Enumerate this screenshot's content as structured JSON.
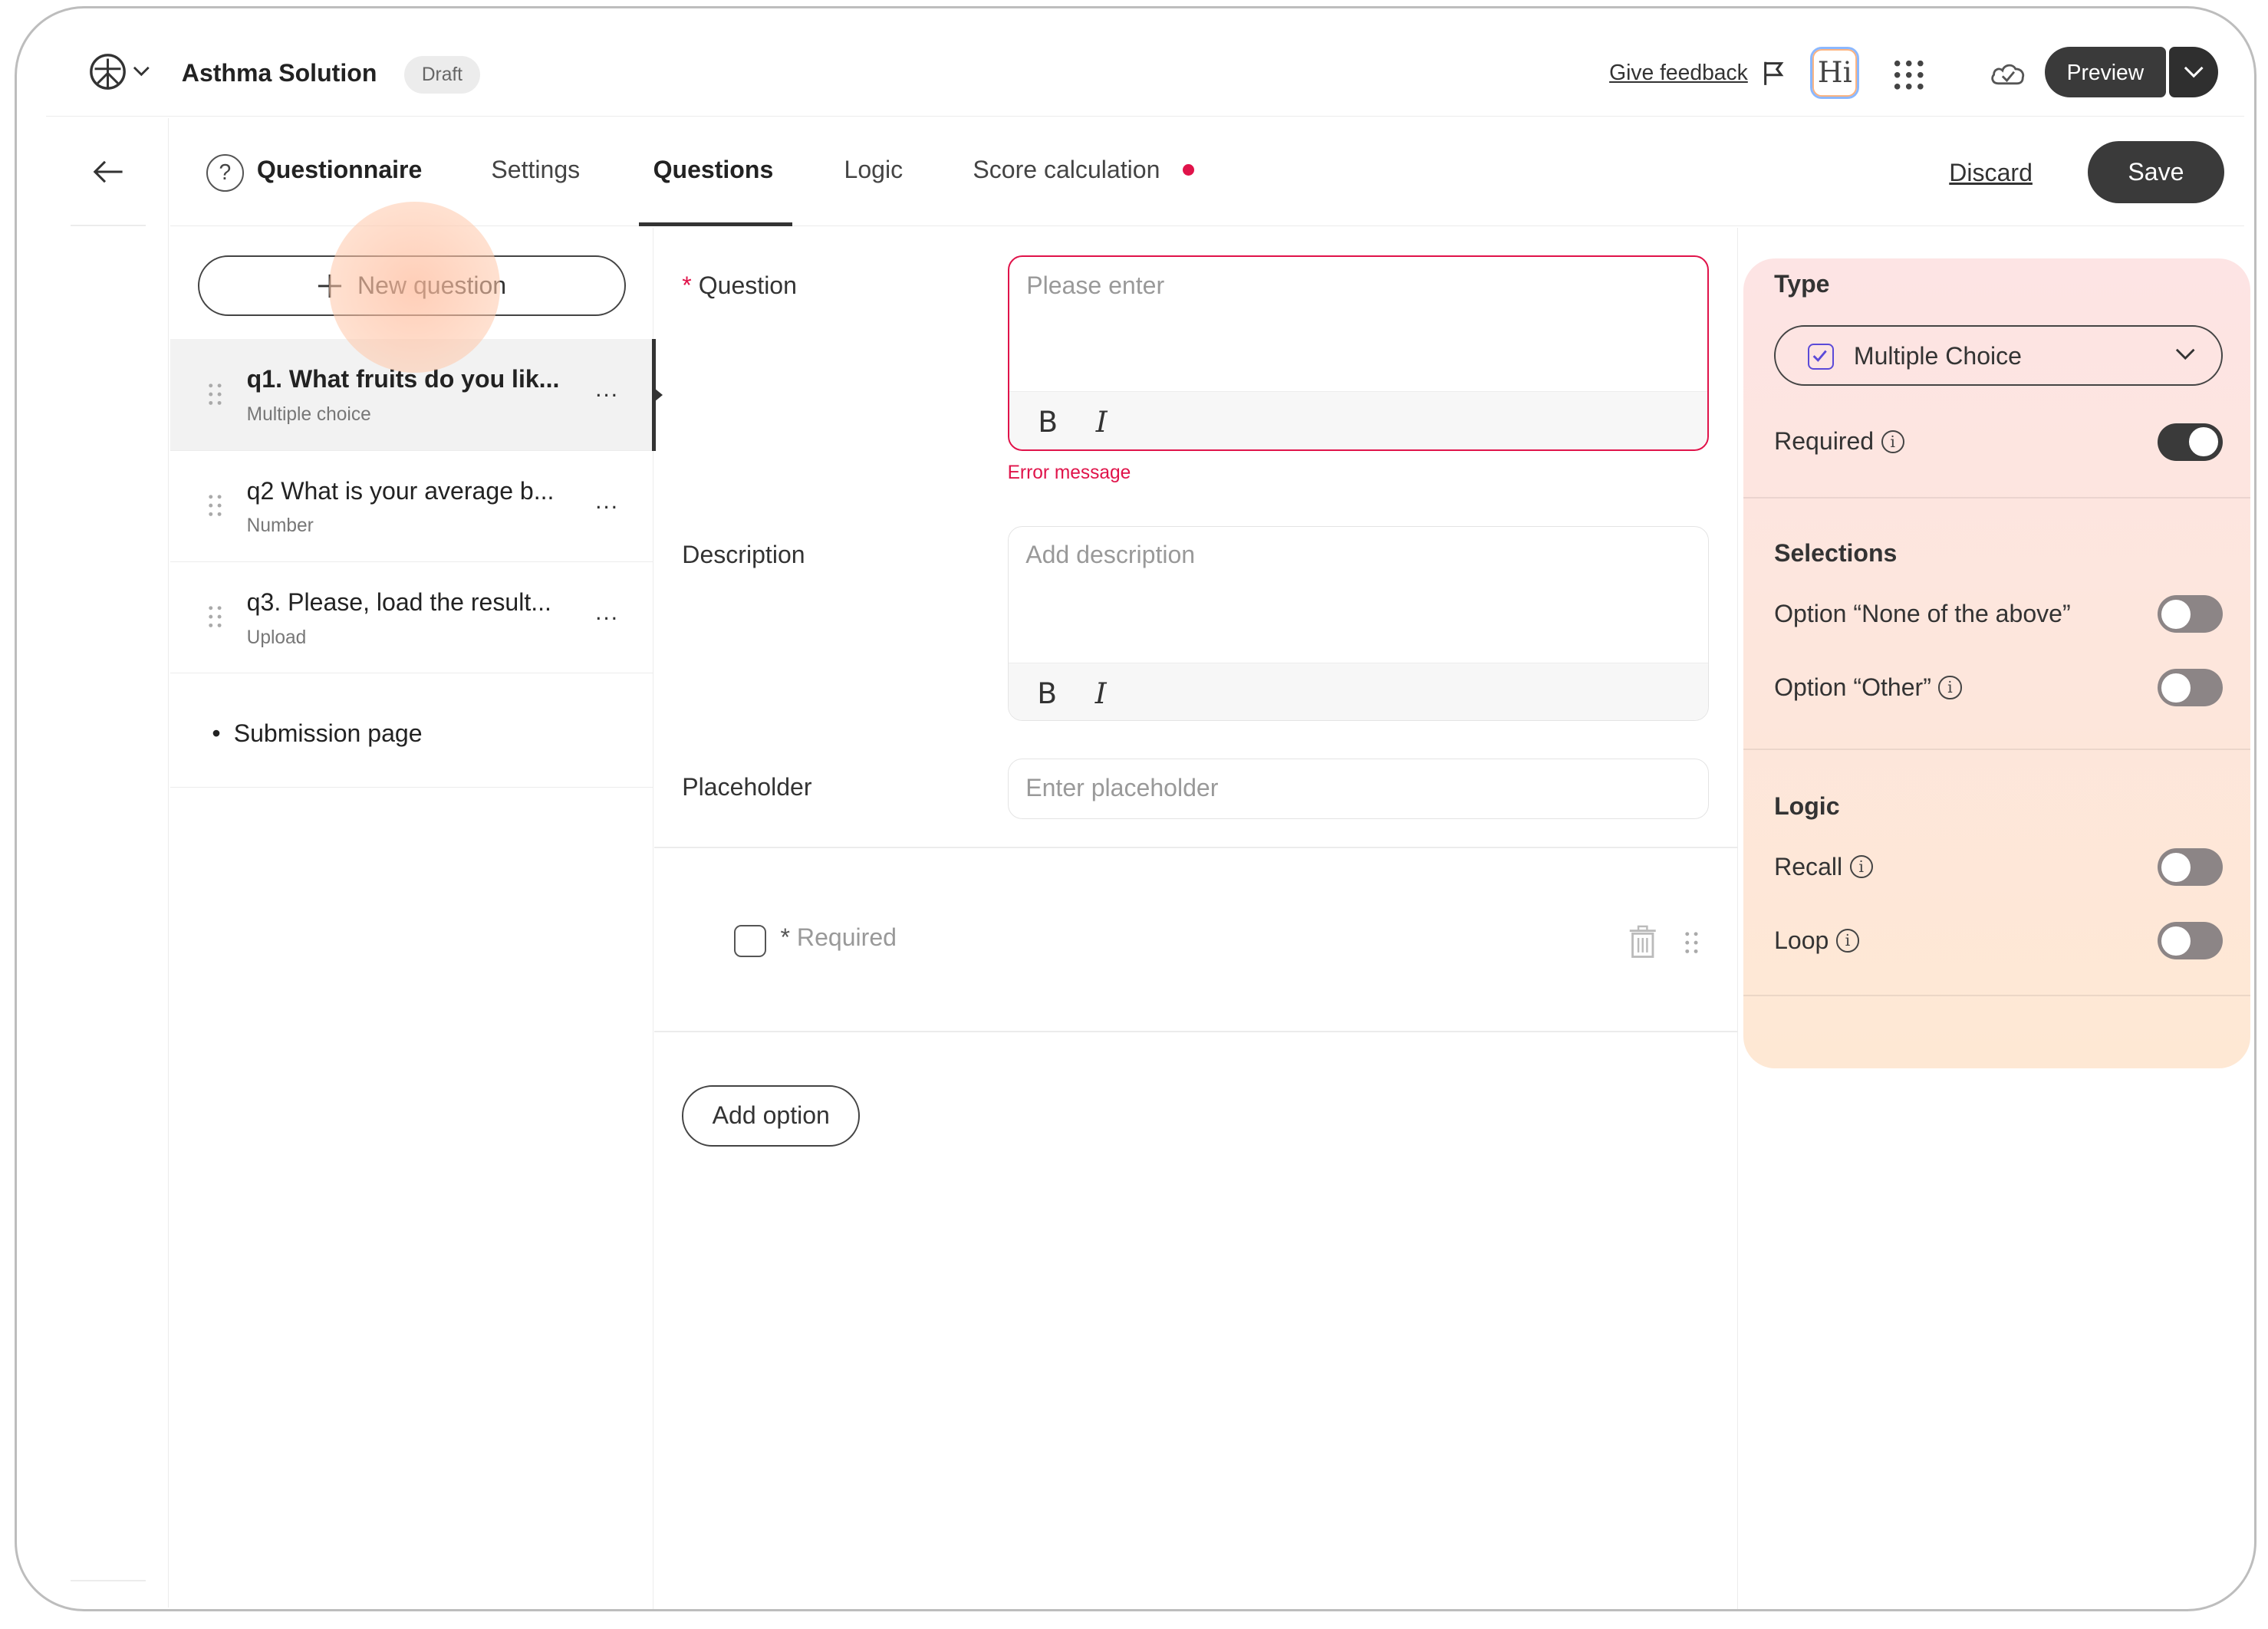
{
  "header": {
    "app_title": "Asthma Solution",
    "status_badge": "Draft",
    "feedback_label": "Give feedback",
    "hi_label": "Hi",
    "preview_label": "Preview"
  },
  "tabs": {
    "section_title": "Questionnaire",
    "items": [
      "Settings",
      "Questions",
      "Logic",
      "Score calculation"
    ],
    "active": "Questions",
    "discard_label": "Discard",
    "save_label": "Save"
  },
  "question_list": {
    "new_question_label": "New question",
    "items": [
      {
        "title": "q1. What fruits do you lik...",
        "type": "Multiple choice"
      },
      {
        "title": "q2 What is your average b...",
        "type": "Number"
      },
      {
        "title": "q3. Please, load the result...",
        "type": "Upload"
      }
    ],
    "more_label": "...",
    "submission_label": "Submission page"
  },
  "editor": {
    "question_label": "Question",
    "question_placeholder": "Please enter",
    "error_message": "Error message",
    "description_label": "Description",
    "description_placeholder": "Add description",
    "placeholder_label": "Placeholder",
    "placeholder_placeholder": "Enter placeholder",
    "bold_label": "B",
    "italic_label": "I",
    "option_label": "Required",
    "add_option_label": "Add option"
  },
  "properties": {
    "type_title": "Type",
    "type_value": "Multiple Choice",
    "required_label": "Required",
    "required_on": true,
    "selections_title": "Selections",
    "none_option_label": "Option “None of the above”",
    "other_option_label": "Option “Other”",
    "logic_title": "Logic",
    "recall_label": "Recall",
    "loop_label": "Loop",
    "info_glyph": "i"
  },
  "colors": {
    "accent_error": "#e0134a",
    "dark_button": "#3a3a3a",
    "panel_gradient_top": "#fde4e4",
    "panel_gradient_bottom": "#fee8d4"
  }
}
